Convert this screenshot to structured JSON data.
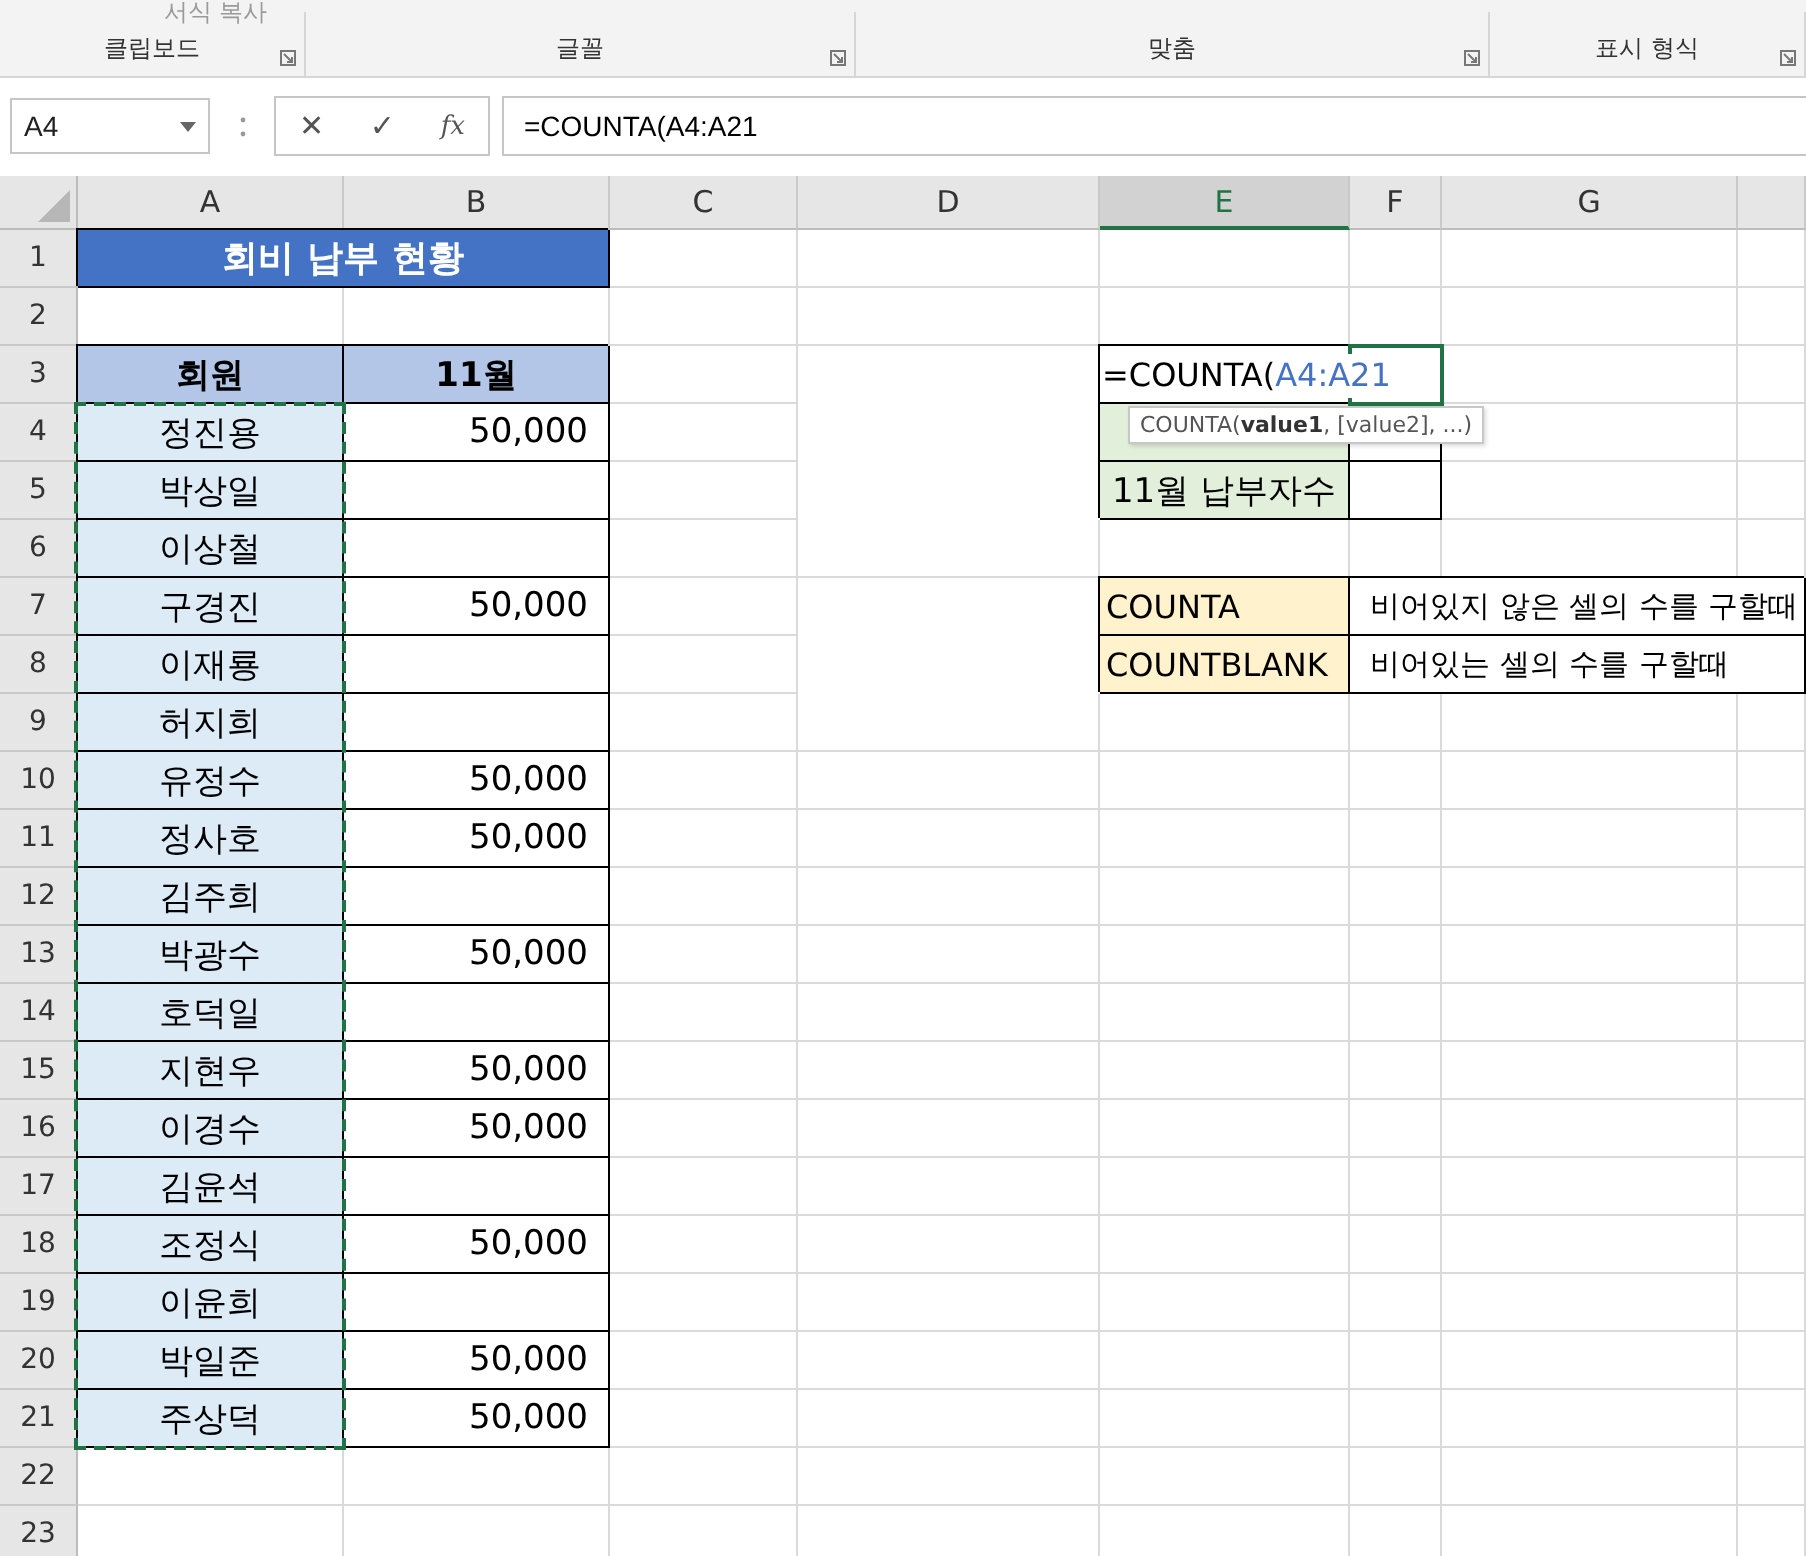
{
  "ribbon": {
    "top_button": "서식 복사",
    "groups": [
      {
        "label": "클립보드"
      },
      {
        "label": "글꼴"
      },
      {
        "label": "맞춤"
      },
      {
        "label": "표시 형식"
      }
    ]
  },
  "name_box": "A4",
  "formula_bar": {
    "cancel": "✕",
    "enter": "✓",
    "function": "fx",
    "formula": "=COUNTA(A4:A21"
  },
  "columns": [
    {
      "label": "A",
      "selected": false
    },
    {
      "label": "B",
      "selected": false
    },
    {
      "label": "C",
      "selected": false
    },
    {
      "label": "D",
      "selected": false
    },
    {
      "label": "E",
      "selected": true
    },
    {
      "label": "F",
      "selected": false
    },
    {
      "label": "G",
      "selected": false
    }
  ],
  "rows": [
    "1",
    "2",
    "3",
    "4",
    "5",
    "6",
    "7",
    "8",
    "9",
    "10",
    "11",
    "12",
    "13",
    "14",
    "15",
    "16",
    "17",
    "18",
    "19",
    "20",
    "21",
    "22",
    "23"
  ],
  "title": "회비 납부 현황",
  "members_table": {
    "headers": [
      "회원",
      "11월"
    ],
    "rows": [
      {
        "name": "정진용",
        "amount": "50,000"
      },
      {
        "name": "박상일"
      },
      {
        "name": "이상철"
      },
      {
        "name": "구경진",
        "amount": "50,000"
      },
      {
        "name": "이재룡"
      },
      {
        "name": "허지희"
      },
      {
        "name": "유정수",
        "amount": "50,000"
      },
      {
        "name": "정사호",
        "amount": "50,000"
      },
      {
        "name": "김주희"
      },
      {
        "name": "박광수",
        "amount": "50,000"
      },
      {
        "name": "호덕일"
      },
      {
        "name": "지현우",
        "amount": "50,000"
      },
      {
        "name": "이경수",
        "amount": "50,000"
      },
      {
        "name": "김윤석"
      },
      {
        "name": "조정식",
        "amount": "50,000"
      },
      {
        "name": "이윤희"
      },
      {
        "name": "박일준",
        "amount": "50,000"
      },
      {
        "name": "주상덕",
        "amount": "50,000"
      }
    ]
  },
  "summary": {
    "formula_prefix": "=COUNTA(",
    "formula_reference": "A4:A21",
    "label": "11월 납부자수",
    "tooltip": "COUNTA(**value1**, [value2], ...)"
  },
  "functions": [
    {
      "name": "COUNTA",
      "description": "비어있지 않은 셀의 수를 구할때"
    },
    {
      "name": "COUNTBLANK",
      "description": "비어있는 셀의 수를 구할때"
    }
  ]
}
